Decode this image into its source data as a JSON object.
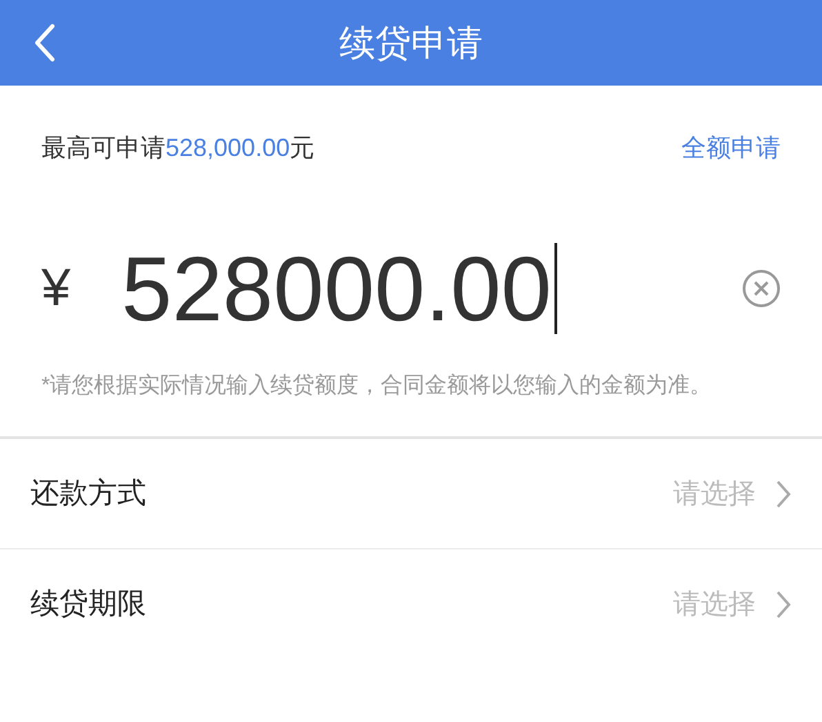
{
  "header": {
    "title": "续贷申请"
  },
  "limit": {
    "prefix": "最高可申请",
    "amount": "528,000.00",
    "suffix": "元",
    "action": "全额申请"
  },
  "amount": {
    "currency": "¥",
    "value": "528000.00",
    "focused": true
  },
  "note": "*请您根据实际情况输入续贷额度，合同金额将以您输入的金额为准。",
  "rows": [
    {
      "label": "还款方式",
      "placeholder": "请选择"
    },
    {
      "label": "续贷期限",
      "placeholder": "请选择"
    }
  ]
}
